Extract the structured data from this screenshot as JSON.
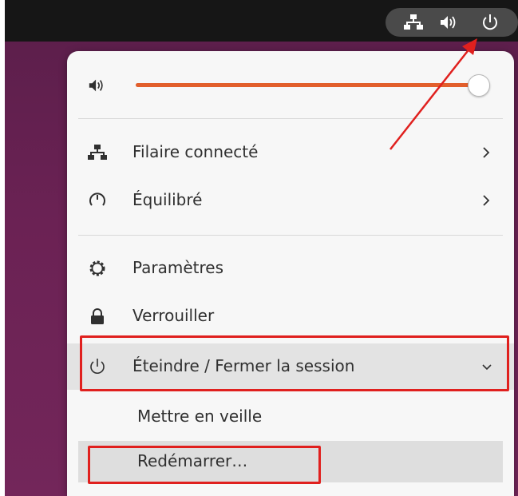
{
  "topbar": {
    "indicators": [
      {
        "icon": "network-wired-icon"
      },
      {
        "icon": "volume-icon"
      },
      {
        "icon": "power-icon"
      }
    ]
  },
  "menu": {
    "volume": {
      "icon": "volume-icon",
      "level": 0.98
    },
    "items": [
      {
        "icon": "network-wired-icon",
        "label": "Filaire connecté",
        "has_submenu": true
      },
      {
        "icon": "power-profile-icon",
        "label": "Équilibré",
        "has_submenu": true
      },
      {
        "icon": "settings-gear-icon",
        "label": "Paramètres",
        "has_submenu": false
      },
      {
        "icon": "lock-icon",
        "label": "Verrouiller",
        "has_submenu": false
      },
      {
        "icon": "power-icon",
        "label": "Éteindre / Fermer la session",
        "has_submenu": true,
        "expanded": true
      }
    ],
    "power_submenu": [
      {
        "label": "Mettre en veille"
      },
      {
        "label": "Redémarrer…"
      }
    ]
  },
  "colors": {
    "accent": "#e25f2c",
    "annotation": "#e0201e",
    "topbar": "#161616",
    "desktop": "#6b2254"
  }
}
